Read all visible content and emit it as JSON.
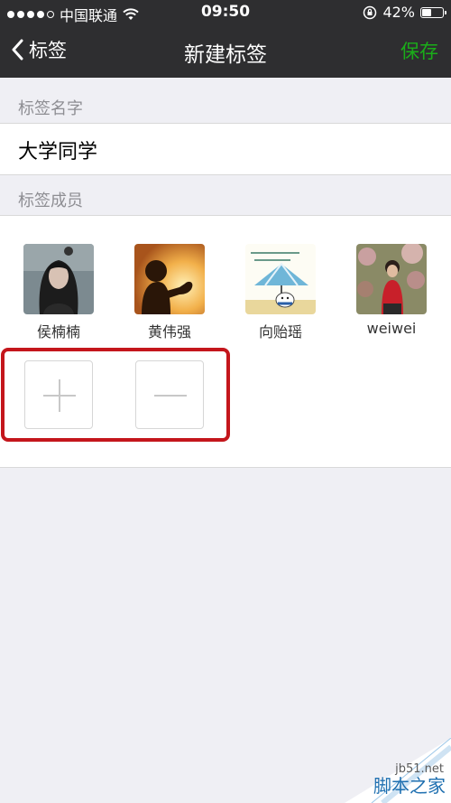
{
  "status_bar": {
    "carrier": "中国联通",
    "time": "09:50",
    "battery": "42%",
    "battery_level": 0.42
  },
  "nav": {
    "back_label": "标签",
    "title": "新建标签",
    "save_label": "保存"
  },
  "sections": {
    "name_header": "标签名字",
    "name_value": "大学同学",
    "members_header": "标签成员"
  },
  "members": [
    {
      "name": "侯楠楠"
    },
    {
      "name": "黄伟强"
    },
    {
      "name": "向贻瑶"
    },
    {
      "name": "weiwei"
    }
  ],
  "actions": {
    "add_icon": "plus-icon",
    "remove_icon": "minus-icon"
  },
  "watermark": {
    "domain": "jb51.net",
    "name": "脚本之家"
  },
  "colors": {
    "nav_background": "#2e2e30",
    "save_accent": "#1aad19",
    "highlight": "#c4161c",
    "page_background": "#efeff4"
  }
}
